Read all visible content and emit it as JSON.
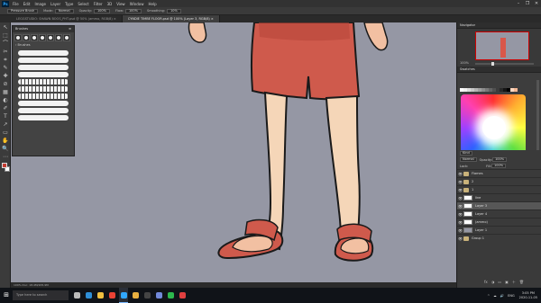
{
  "menubar": {
    "app_logo": "Ps",
    "items": [
      "File",
      "Edit",
      "Image",
      "Layer",
      "Type",
      "Select",
      "Filter",
      "3D",
      "View",
      "Window",
      "Help"
    ],
    "window_controls": [
      "–",
      "❐",
      "✕"
    ]
  },
  "options": {
    "preset": "Pressure Brush",
    "mode_label": "Mode:",
    "mode_value": "Normal",
    "opacity_label": "Opacity:",
    "opacity_value": "100%",
    "flow_label": "Flow:",
    "flow_value": "100%",
    "smoothing_label": "Smoothing:",
    "smoothing_value": "10%"
  },
  "tabs": [
    {
      "label": "LEGGSTUDIO: SHAWN BOOS_PHT.psd @ 50% (ammo, RGB/8) ×",
      "active": false
    },
    {
      "label": "CYNDIE TIMBE FLOOR.psd @ 100% (Layer 3, RGB/8) ×",
      "active": true
    }
  ],
  "tools": [
    "↖",
    "⬚",
    "⌒",
    "✂",
    "⌗",
    "✎",
    "✚",
    "⊘",
    "▦",
    "◐",
    "✐",
    "T",
    "↗",
    "▭",
    "✋",
    "🔍",
    "⋯"
  ],
  "brushes_panel": {
    "title": "Brushes",
    "folder_label": "› Brushes",
    "size_labels": [
      "30",
      "30",
      "30",
      "25",
      "25",
      "36",
      "25",
      "36"
    ]
  },
  "navigator": {
    "title": "Navigator",
    "zoom": "100%"
  },
  "swatches": {
    "title": "Swatches",
    "colors": [
      "#ffffff",
      "#f0f0f0",
      "#dcdcdc",
      "#c8c8c8",
      "#b4b4b4",
      "#a0a0a0",
      "#8c8c8c",
      "#787878",
      "#646464",
      "#505050",
      "#3c3c3c",
      "#282828",
      "#141414",
      "#000000",
      "#ffd8c0",
      "#f4b896",
      "#e8a07a",
      "#d38763",
      "#c06e50",
      "#a45a40",
      "#8a4a32",
      "#ff6060",
      "#ff9966",
      "#ffcc66",
      "#ffff66",
      "#99ff66",
      "#66ffcc",
      "#66ccff",
      "#6699ff",
      "#9966ff",
      "#cc66ff",
      "#ff66cc",
      "#cc3333",
      "#cc6633",
      "#cc9933",
      "#cccc33",
      "#66cc33",
      "#33cc99",
      "#3399cc",
      "#3366cc",
      "#6633cc",
      "#9933cc",
      "#cc3399",
      "#993333",
      "#996633",
      "#999933",
      "#339966",
      "#336699"
    ]
  },
  "layers": {
    "kind_label": "Kind",
    "blend_mode": "Normal",
    "opacity_label": "Opacity:",
    "opacity_value": "100%",
    "fill_label": "Fill:",
    "fill_value": "100%",
    "lock_label": "Lock:",
    "rows": [
      {
        "name": "Flames",
        "type": "folder",
        "selected": false
      },
      {
        "name": "2",
        "type": "folder",
        "selected": false
      },
      {
        "name": "1",
        "type": "folder",
        "selected": false
      },
      {
        "name": "line",
        "type": "layer",
        "selected": false
      },
      {
        "name": "Layer 3",
        "type": "layer",
        "selected": true
      },
      {
        "name": "Layer 4",
        "type": "layer",
        "selected": false
      },
      {
        "name": "(ammo)",
        "type": "layer",
        "selected": false
      },
      {
        "name": "Layer 1",
        "type": "gray",
        "selected": false
      },
      {
        "name": "Group 1",
        "type": "folder",
        "selected": false
      }
    ],
    "footer_icons": [
      "fx",
      "◑",
      "▭",
      "▣",
      "＋",
      "🗑"
    ]
  },
  "statusbar": {
    "text": "100%    Doc: 18.4M/205.9M"
  },
  "taskbar": {
    "start": "⊞",
    "search_placeholder": "Type here to search",
    "apps": [
      {
        "name": "task-view",
        "color": "#bbbbbb"
      },
      {
        "name": "edge",
        "color": "#2f8fd8"
      },
      {
        "name": "explorer",
        "color": "#f0c040"
      },
      {
        "name": "chrome",
        "color": "#ea4335"
      },
      {
        "name": "photoshop",
        "color": "#31a8ff"
      },
      {
        "name": "files",
        "color": "#e8b040"
      },
      {
        "name": "obs",
        "color": "#444444"
      },
      {
        "name": "discord",
        "color": "#7289da"
      },
      {
        "name": "app-green",
        "color": "#2db84d"
      },
      {
        "name": "app-red",
        "color": "#e04040"
      }
    ],
    "tray_icons": [
      "^",
      "☁",
      "🔊",
      "ENG"
    ],
    "time": "3:05 PM",
    "date": "2020-11-05"
  }
}
